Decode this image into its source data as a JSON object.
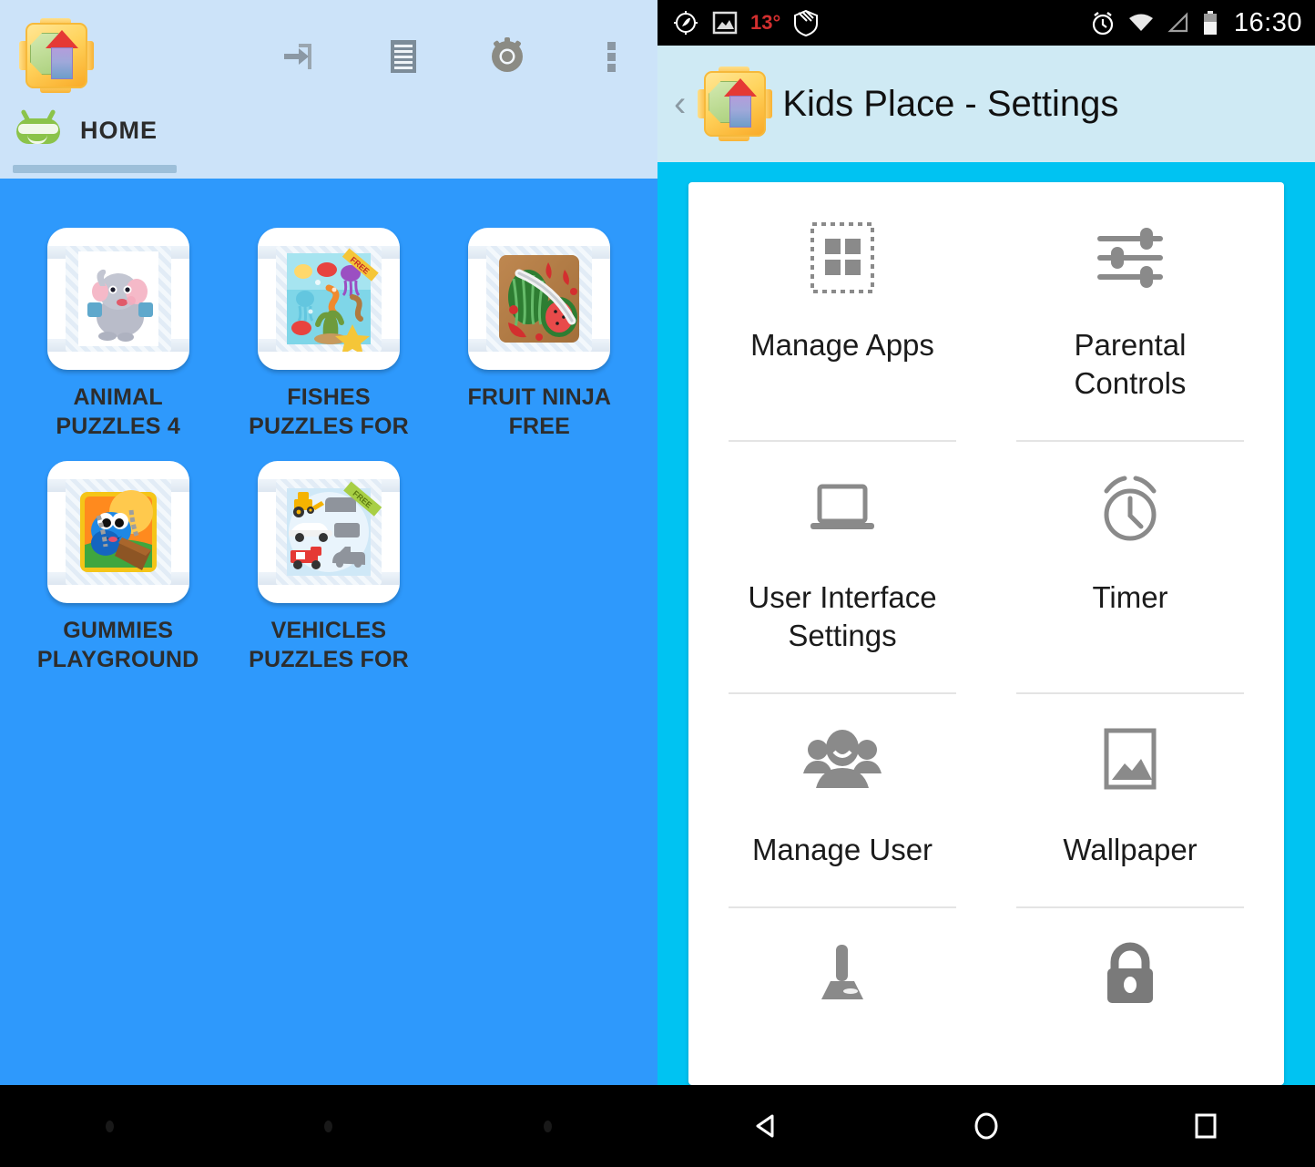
{
  "left_screen": {
    "app_logo_name": "kids-place-logo",
    "toolbar": {
      "icons": [
        {
          "name": "exit-app-icon",
          "label": "Exit"
        },
        {
          "name": "list-icon",
          "label": "List"
        },
        {
          "name": "settings-gear-icon",
          "label": "Settings"
        },
        {
          "name": "overflow-menu-icon",
          "label": "More options"
        }
      ]
    },
    "tabs": [
      {
        "label": "HOME",
        "icon": "android-robot-icon",
        "selected": true
      }
    ],
    "apps": [
      {
        "label": "ANIMAL\nPUZZLES 4",
        "line1": "ANIMAL",
        "line2": "PUZZLES 4",
        "art": "elephant-puzzle"
      },
      {
        "label": "FISHES\nPUZZLES FOR",
        "line1": "FISHES",
        "line2": "PUZZLES FOR",
        "art": "fishes-puzzle",
        "badge": "FREE"
      },
      {
        "label": "FRUIT NINJA\nFREE",
        "line1": "FRUIT NINJA",
        "line2": "FREE",
        "art": "fruit-ninja"
      },
      {
        "label": "GUMMIES\nPLAYGROUND",
        "line1": "GUMMIES",
        "line2": "PLAYGROUND",
        "art": "gummies-playground"
      },
      {
        "label": "VEHICLES\nPUZZLES FOR",
        "line1": "VEHICLES",
        "line2": "PUZZLES FOR",
        "art": "vehicles-puzzle",
        "badge": "FREE"
      }
    ],
    "navbar": [
      {
        "name": "back-button"
      },
      {
        "name": "home-button"
      },
      {
        "name": "recents-button"
      }
    ],
    "colors": {
      "header_bg": "#cce3f9",
      "body_bg": "#2e99fc",
      "tab_underline": "#9dbfd9",
      "label_text": "#2d2d2d"
    }
  },
  "right_screen": {
    "statusbar": {
      "left_icons": [
        {
          "name": "compass-tool-icon"
        },
        {
          "name": "image-icon"
        },
        {
          "name": "shield-icon"
        }
      ],
      "temperature": "13°",
      "right_icons": [
        {
          "name": "alarm-clock-icon"
        },
        {
          "name": "wifi-icon"
        },
        {
          "name": "cell-signal-icon"
        },
        {
          "name": "battery-icon"
        }
      ],
      "time": "16:30"
    },
    "titlebar": {
      "back_icon": "back-chevron-icon",
      "app_logo_name": "kids-place-logo",
      "title": "Kids Place - Settings"
    },
    "settings_items": [
      {
        "label": "Manage Apps",
        "icon": "apps-grid-icon"
      },
      {
        "label": "Parental Controls",
        "icon": "sliders-icon"
      },
      {
        "label": "User Interface Settings",
        "line1": "User Interface",
        "line2": "Settings",
        "icon": "laptop-icon"
      },
      {
        "label": "Timer",
        "icon": "alarm-clock-icon"
      },
      {
        "label": "Manage User",
        "icon": "people-group-icon"
      },
      {
        "label": "Wallpaper",
        "icon": "picture-frame-icon"
      },
      {
        "label": "",
        "icon": "joystick-icon"
      },
      {
        "label": "",
        "icon": "padlock-icon"
      }
    ],
    "navbar": [
      {
        "name": "back-button"
      },
      {
        "name": "home-button"
      },
      {
        "name": "recents-button"
      }
    ],
    "colors": {
      "titlebar_bg": "#cfeaf4",
      "body_bg": "#00c3f2",
      "card_bg": "#ffffff",
      "icon_gray": "#8a8a8a",
      "divider": "#e4e4e4",
      "temp_red": "#d32f2f"
    }
  }
}
